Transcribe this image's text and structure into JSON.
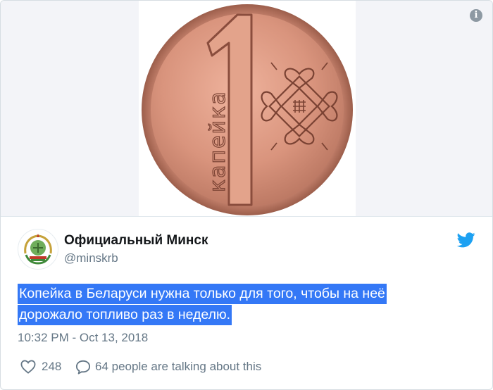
{
  "media": {
    "coin_numeral": "1",
    "coin_text": "капейка",
    "coin_color": "#d9947d",
    "info_icon": "info-icon",
    "info_glyph": "i"
  },
  "author": {
    "display_name": "Официальный Минск",
    "handle": "@minskrb",
    "avatar_icon": "coat-of-arms-icon"
  },
  "brand": {
    "icon": "twitter-bird-icon",
    "color": "#1da1f2"
  },
  "tweet": {
    "text_line_1": "Копейка в Беларуси нужна только для того, чтобы на неё",
    "text_line_2": "дорожало топливо раз в неделю.",
    "highlight_color": "#3478f6",
    "timestamp": "10:32 PM - Oct 13, 2018"
  },
  "actions": {
    "like_icon": "heart-icon",
    "like_count": "248",
    "reply_icon": "comment-bubble-icon",
    "talking_label": "64 people are talking about this"
  }
}
